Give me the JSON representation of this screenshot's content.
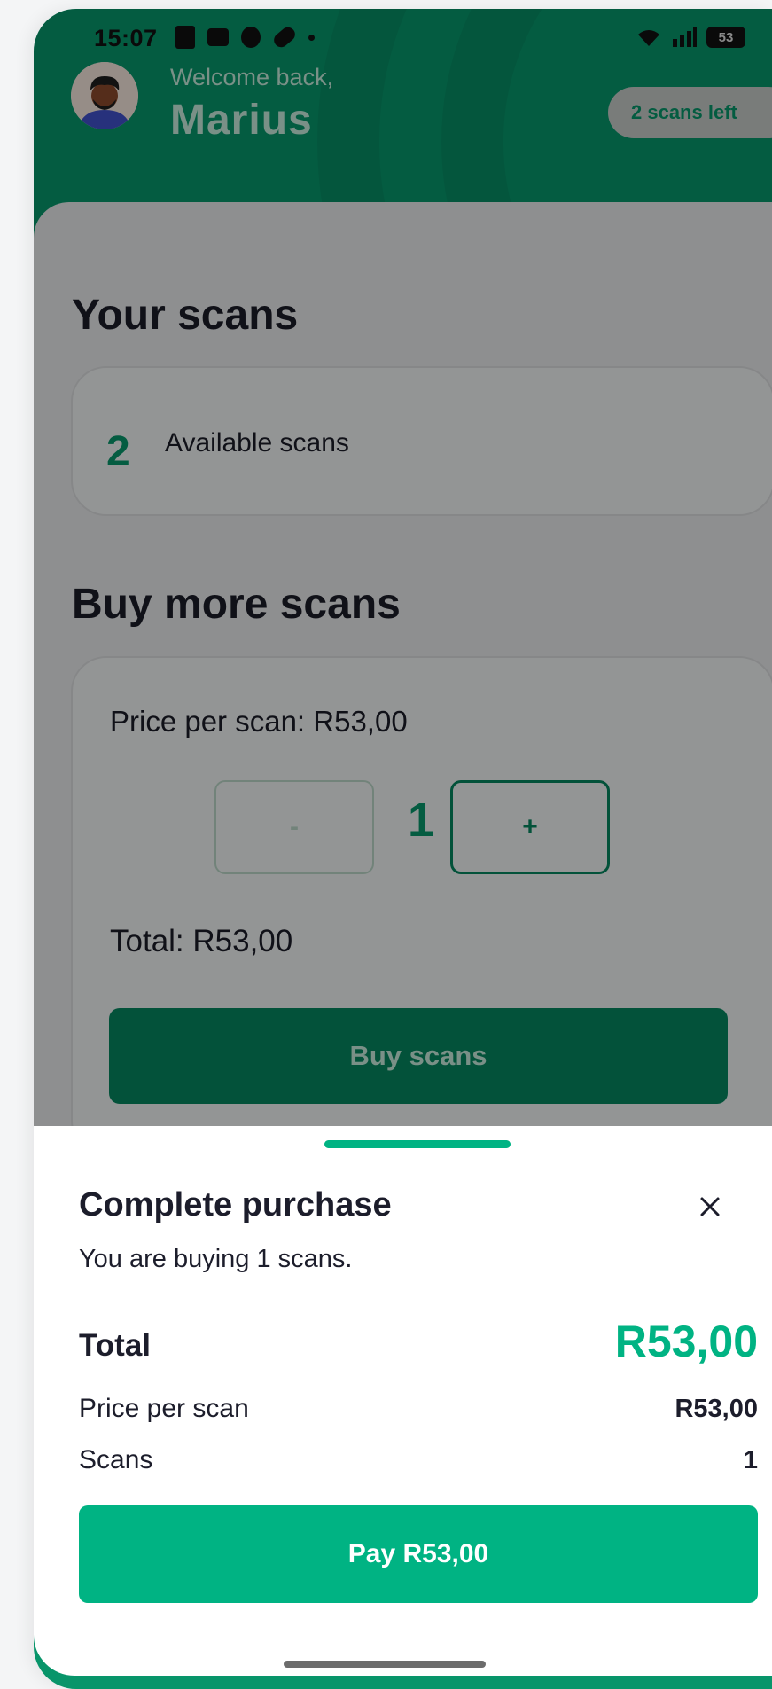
{
  "status_bar": {
    "time": "15:07",
    "battery": "53"
  },
  "header": {
    "welcome": "Welcome back,",
    "name": "Marius",
    "scans_left": "2 scans left"
  },
  "your_scans": {
    "title": "Your scans",
    "count": "2",
    "label": "Available scans"
  },
  "buy": {
    "title": "Buy more scans",
    "price_per_scan": "Price per scan: R53,00",
    "minus_label": "-",
    "quantity": "1",
    "plus_label": "+",
    "total": "Total: R53,00",
    "buy_button": "Buy scans"
  },
  "sheet": {
    "title": "Complete purchase",
    "subtitle": "You are buying 1 scans.",
    "total_label": "Total",
    "total_value": "R53,00",
    "price_label": "Price per scan",
    "price_value": "R53,00",
    "scans_label": "Scans",
    "scans_value": "1",
    "pay_button": "Pay R53,00"
  },
  "colors": {
    "brand": "#08956a",
    "accent": "#00b383"
  }
}
